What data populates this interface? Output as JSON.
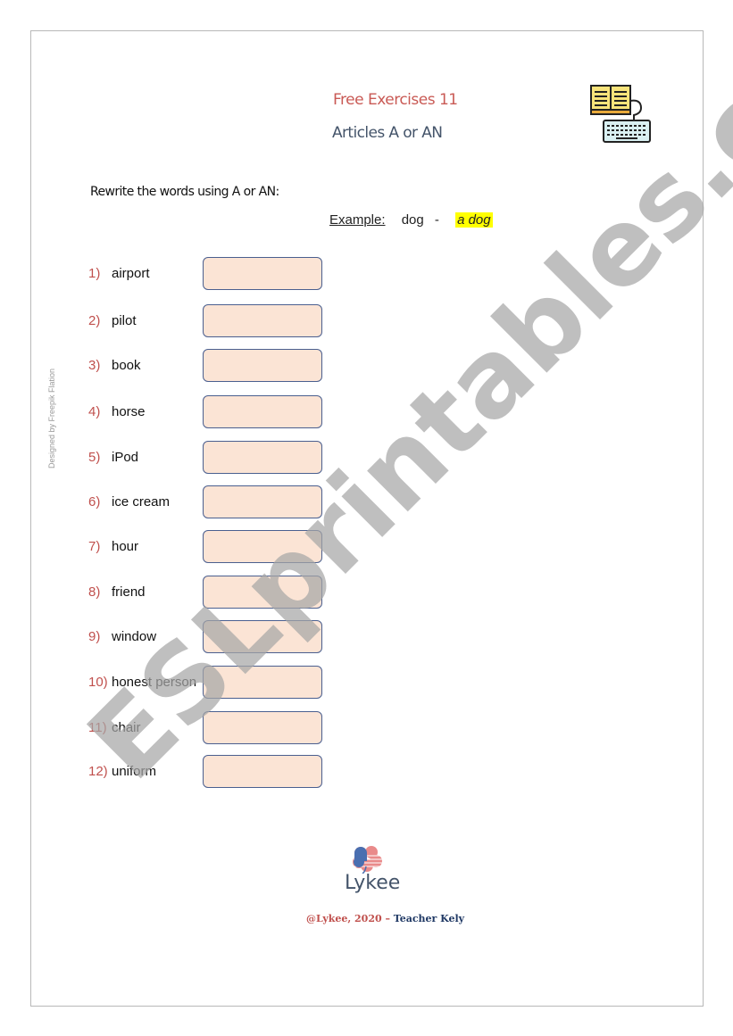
{
  "header": {
    "title": "Free Exercises 11",
    "subtitle": "Articles A or AN",
    "icon": "book-keyboard-icon"
  },
  "instruction": "Rewrite the words using A or AN:",
  "example": {
    "label": "Example:",
    "word": "dog",
    "dash": "-",
    "answer": "a dog"
  },
  "items": [
    {
      "num": "1)",
      "word": "airport",
      "answer": ""
    },
    {
      "num": "2)",
      "word": "pilot",
      "answer": ""
    },
    {
      "num": "3)",
      "word": "book",
      "answer": ""
    },
    {
      "num": "4)",
      "word": "horse",
      "answer": ""
    },
    {
      "num": "5)",
      "word": "iPod",
      "answer": ""
    },
    {
      "num": "6)",
      "word": "ice cream",
      "answer": ""
    },
    {
      "num": "7)",
      "word": "hour",
      "answer": ""
    },
    {
      "num": "8)",
      "word": "friend",
      "answer": ""
    },
    {
      "num": "9)",
      "word": "window",
      "answer": ""
    },
    {
      "num": "10)",
      "word": "honest person",
      "answer": ""
    },
    {
      "num": "11)",
      "word": "chair",
      "answer": ""
    },
    {
      "num": "12)",
      "word": "uniform",
      "answer": ""
    }
  ],
  "side_credit": "Designed by Freepik Flation",
  "watermark": "ESLprintables.com",
  "footer": {
    "brand": "Lykee",
    "copyright_part1": "@Lykee, 2020 – ",
    "copyright_part2": "Teacher Kely"
  },
  "colors": {
    "title": "#c95a55",
    "subtitle": "#44546a",
    "number": "#c0504d",
    "box_fill": "#fbe4d5",
    "box_border": "#4a5f8f",
    "highlight": "#ffff00"
  }
}
